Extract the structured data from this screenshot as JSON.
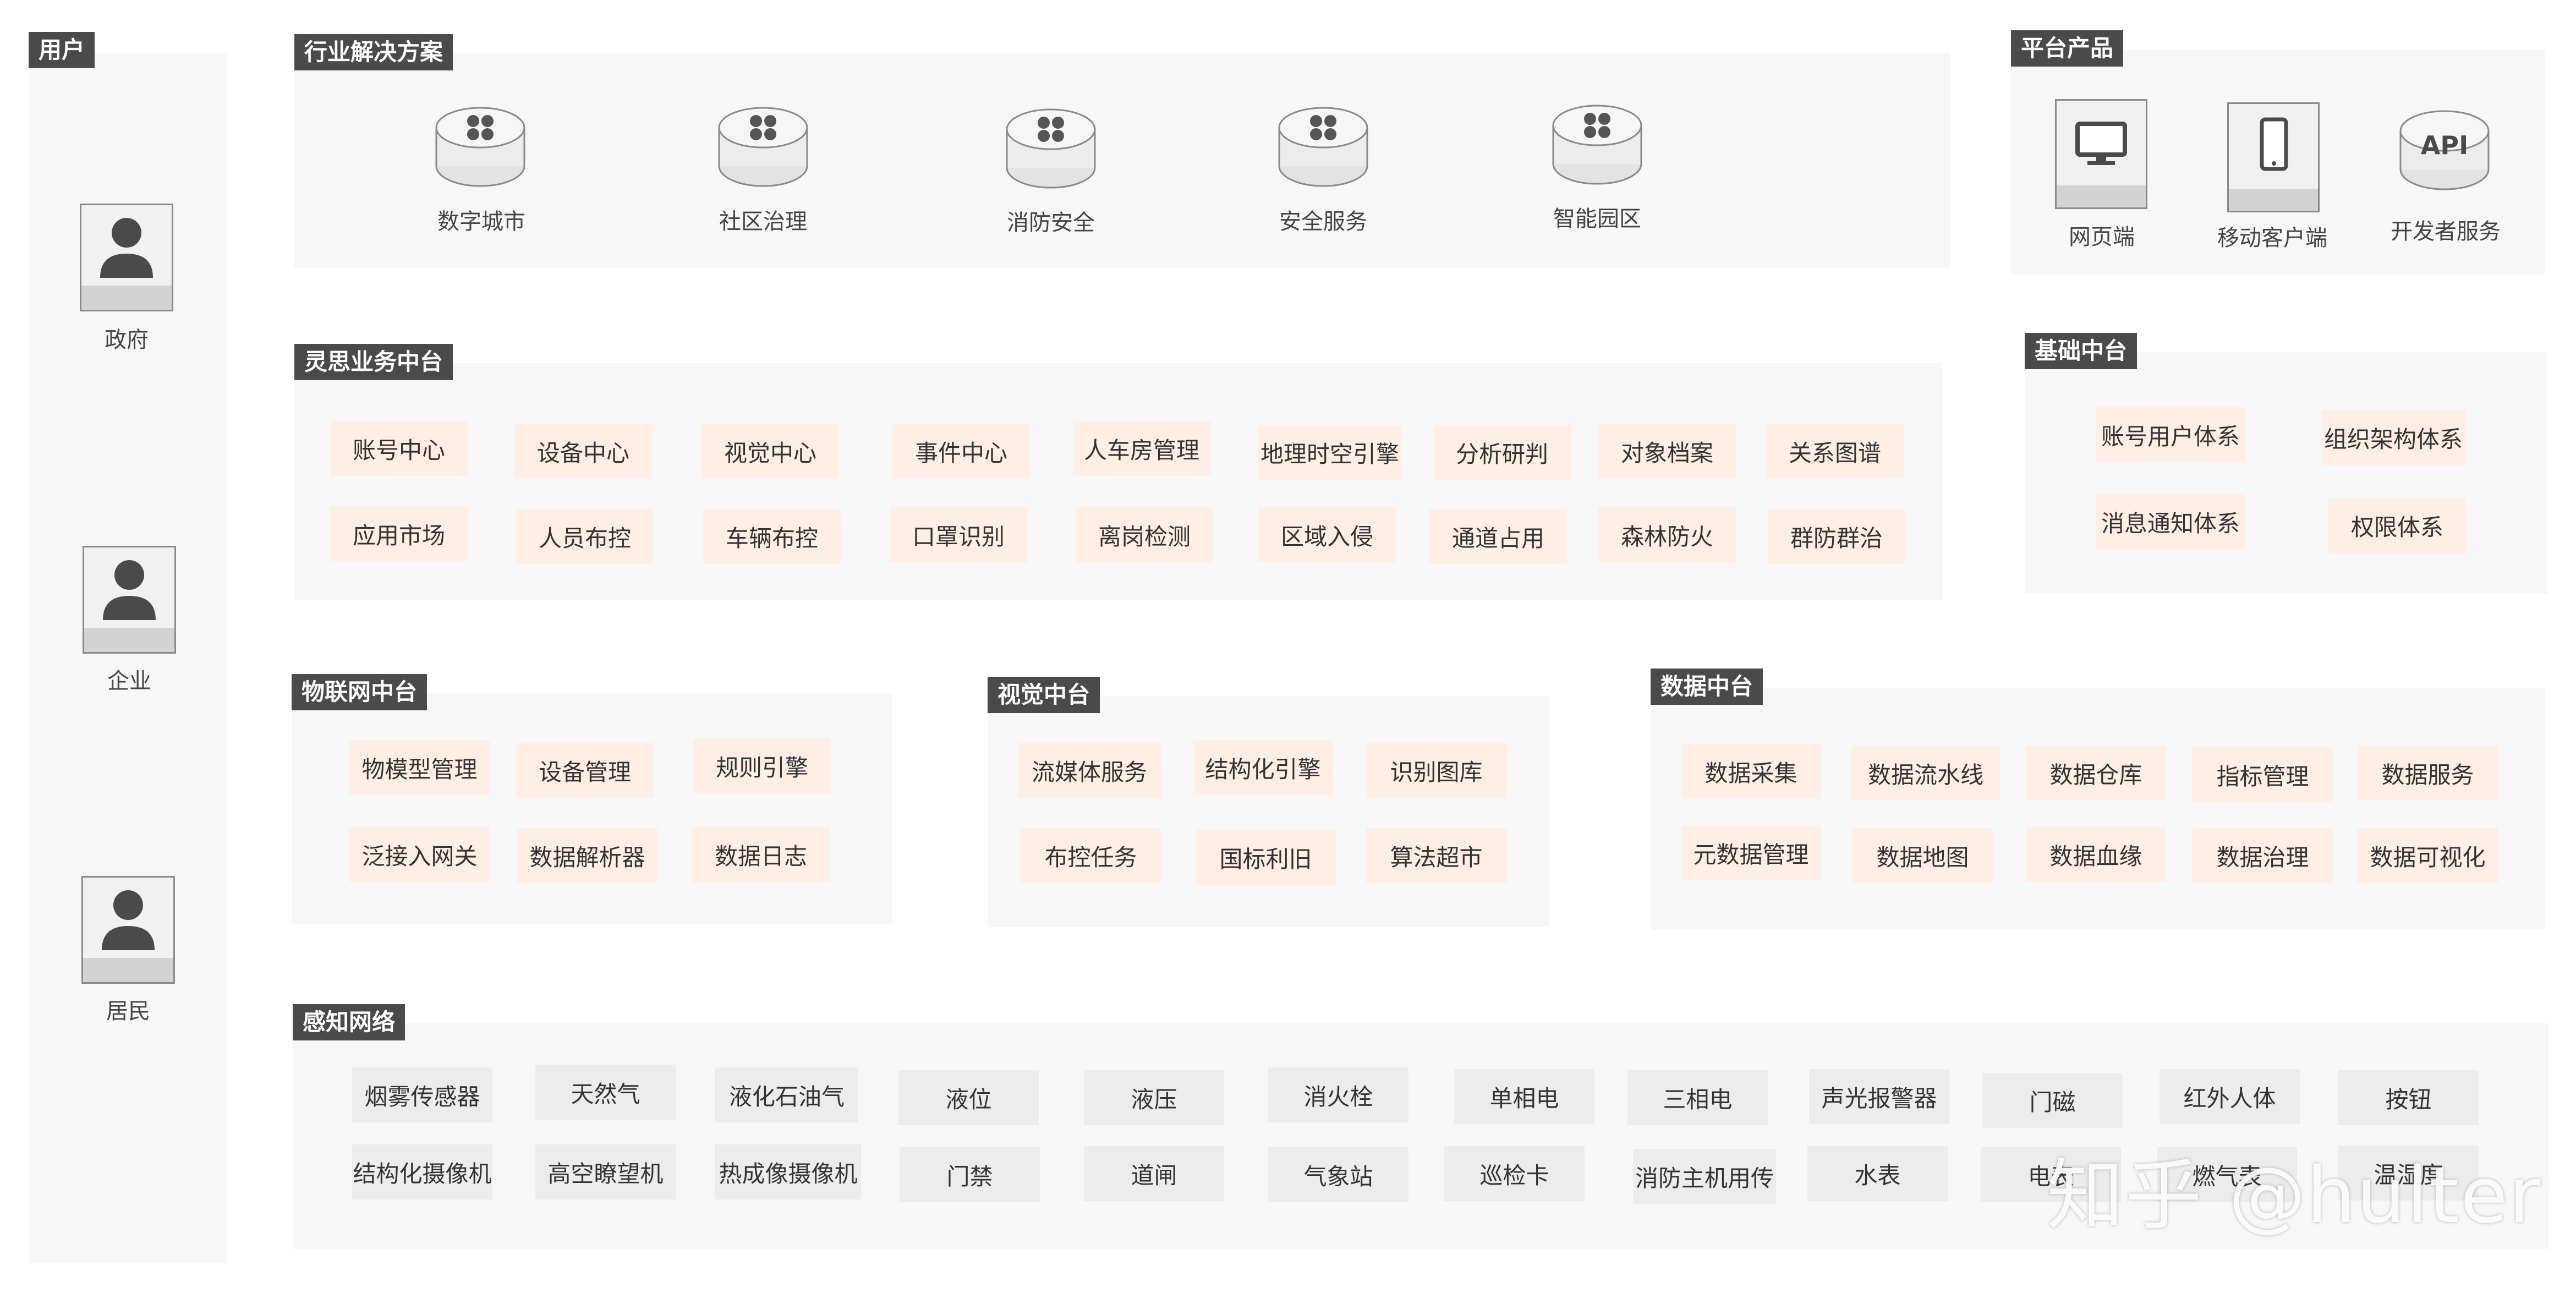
{
  "users": {
    "title": "用户",
    "items": [
      "政府",
      "企业",
      "居民"
    ]
  },
  "industry": {
    "title": "行业解决方案",
    "items": [
      "数字城市",
      "社区治理",
      "消防安全",
      "安全服务",
      "智能园区"
    ]
  },
  "platform": {
    "title": "平台产品",
    "items": [
      "网页端",
      "移动客户端",
      "开发者服务"
    ],
    "api_label": "API"
  },
  "business": {
    "title": "灵思业务中台",
    "row1": [
      "账号中心",
      "设备中心",
      "视觉中心",
      "事件中心",
      "人车房管理",
      "地理时空引擎",
      "分析研判",
      "对象档案",
      "关系图谱"
    ],
    "row2": [
      "应用市场",
      "人员布控",
      "车辆布控",
      "口罩识别",
      "离岗检测",
      "区域入侵",
      "通道占用",
      "森林防火",
      "群防群治"
    ]
  },
  "foundation": {
    "title": "基础中台",
    "row1": [
      "账号用户体系",
      "组织架构体系"
    ],
    "row2": [
      "消息通知体系",
      "权限体系"
    ]
  },
  "iot": {
    "title": "物联网中台",
    "row1": [
      "物模型管理",
      "设备管理",
      "规则引擎"
    ],
    "row2": [
      "泛接入网关",
      "数据解析器",
      "数据日志"
    ]
  },
  "vision": {
    "title": "视觉中台",
    "row1": [
      "流媒体服务",
      "结构化引擎",
      "识别图库"
    ],
    "row2": [
      "布控任务",
      "国标利旧",
      "算法超市"
    ]
  },
  "data": {
    "title": "数据中台",
    "row1": [
      "数据采集",
      "数据流水线",
      "数据仓库",
      "指标管理",
      "数据服务"
    ],
    "row2": [
      "元数据管理",
      "数据地图",
      "数据血缘",
      "数据治理",
      "数据可视化"
    ]
  },
  "sensing": {
    "title": "感知网络",
    "row1": [
      "烟雾传感器",
      "天然气",
      "液化石油气",
      "液位",
      "液压",
      "消火栓",
      "单相电",
      "三相电",
      "声光报警器",
      "门磁",
      "红外人体",
      "按钮"
    ],
    "row2": [
      "结构化摄像机",
      "高空瞭望机",
      "热成像摄像机",
      "门禁",
      "道闸",
      "气象站",
      "巡检卡",
      "消防主机用传",
      "水表",
      "电表",
      "燃气表",
      "温湿度"
    ]
  },
  "watermark": "知乎 @hulter",
  "colors": {
    "tag_bg": "#4a4a4a",
    "panel_bg": "#f7f7f7",
    "chip_orange": "#fdeee6",
    "chip_gray": "#ececec"
  }
}
